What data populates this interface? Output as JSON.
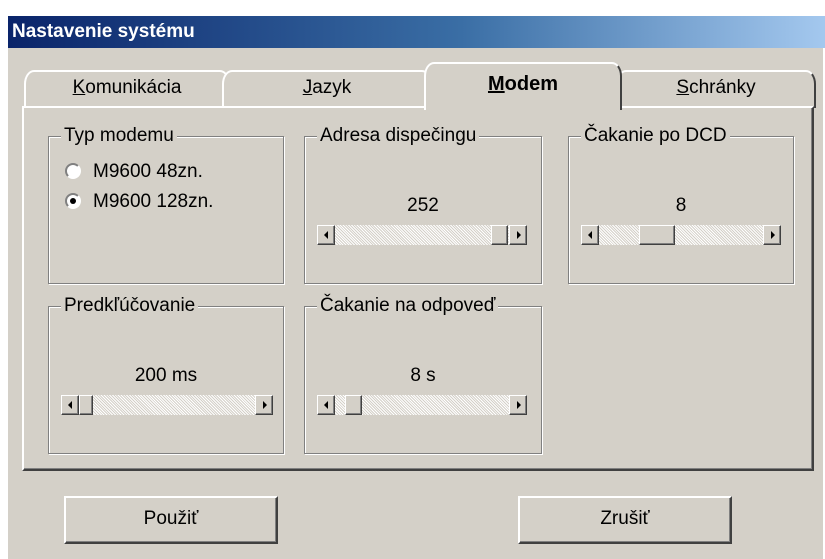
{
  "window": {
    "title": "Nastavenie systému"
  },
  "tabs": [
    {
      "label": "Komunikácia",
      "mnemonic": "K",
      "rest": "omunikácia",
      "active": false
    },
    {
      "label": "Jazyk",
      "mnemonic": "J",
      "rest": "azyk",
      "active": false
    },
    {
      "label": "Modem",
      "mnemonic": "M",
      "rest": "odem",
      "active": true
    },
    {
      "label": "Schránky",
      "mnemonic": "S",
      "rest": "chránky",
      "active": false
    }
  ],
  "groups": {
    "modem_type": {
      "title": "Typ modemu",
      "options": [
        {
          "label": "M9600 48zn.",
          "selected": false
        },
        {
          "label": "M9600 128zn.",
          "selected": true
        }
      ]
    },
    "dispatch_address": {
      "title": "Adresa dispečingu",
      "value": "252",
      "level": 1.0
    },
    "dcd_wait": {
      "title": "Čakanie po DCD",
      "value": "8",
      "level": 0.15
    },
    "pre_keying": {
      "title": "Predkľúčovanie",
      "value": "200 ms",
      "level": 0.0
    },
    "response_wait": {
      "title": "Čakanie na odpoveď",
      "value": "8 s",
      "level": 0.05
    }
  },
  "buttons": {
    "apply": "Použiť",
    "cancel": "Zrušiť"
  },
  "colors": {
    "face": "#d4d0c8",
    "title_start": "#0a246a",
    "title_end": "#a6caf0"
  }
}
